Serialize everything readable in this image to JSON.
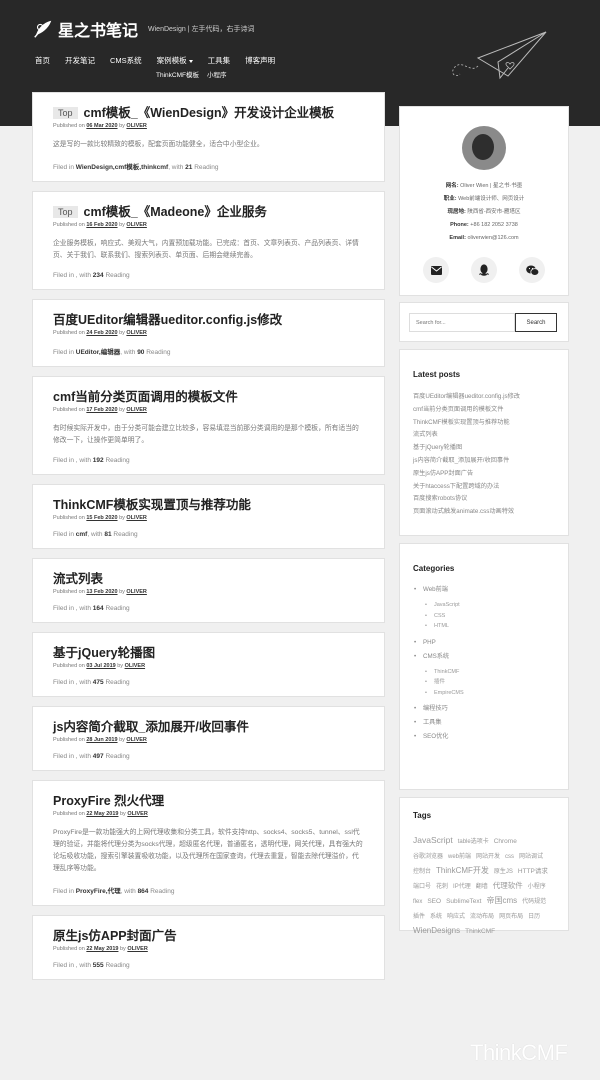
{
  "site": {
    "title": "星之书笔记",
    "description": "WienDesign | 左手代码，右手诗词"
  },
  "nav": {
    "items": [
      "首页",
      "开发笔记",
      "CMS系统",
      "案例模板",
      "工具集",
      "博客声明"
    ],
    "submenu": [
      "ThinkCMF模板",
      "小程序"
    ]
  },
  "posts": [
    {
      "top": "Top",
      "title": "cmf模板_《WienDesign》开发设计企业模板",
      "published": "Published on",
      "date": "06 Mar 2020",
      "by": "by",
      "author": "OLIVER",
      "excerpt": "这是写的一款比较精致的模板，配套页面功能健全，适合中小型企业。",
      "filed_prefix": "Filed in",
      "categories": "WienDesign,cmf模板,thinkcmf",
      "with": ", with",
      "count": "21",
      "reading": "Reading"
    },
    {
      "top": "Top",
      "title": "cmf模板_《Madeone》企业服务",
      "published": "Published on",
      "date": "16 Feb 2020",
      "by": "by",
      "author": "OLIVER",
      "excerpt": "企业服务模板，响应式、美观大气，内置预加载功能。已完成：首页、文章列表页、产品列表页、详情页、关于我们、联系我们、搜索列表页、单页面、后期会继续完善。",
      "filed_prefix": "Filed in",
      "categories": "",
      "with": ", with",
      "count": "234",
      "reading": "Reading"
    },
    {
      "top": "",
      "title": "百度UEditor编辑器ueditor.config.js修改",
      "published": "Published on",
      "date": "24 Feb 2020",
      "by": "by",
      "author": "OLIVER",
      "excerpt": "",
      "filed_prefix": "Filed in",
      "categories": "UEditor,编辑器",
      "with": ", with",
      "count": "90",
      "reading": "Reading"
    },
    {
      "top": "",
      "title": "cmf当前分类页面调用的模板文件",
      "published": "Published on",
      "date": "17 Feb 2020",
      "by": "by",
      "author": "OLIVER",
      "excerpt": "有时候实际开发中，由于分类可能会建立比较多，容易填混当前那分类调用的是那个模板，所有适当的修改一下，让操作更简单明了。",
      "filed_prefix": "Filed in",
      "categories": "",
      "with": ", with",
      "count": "192",
      "reading": "Reading"
    },
    {
      "top": "",
      "title": "ThinkCMF模板实现置顶与推荐功能",
      "published": "Published on",
      "date": "15 Feb 2020",
      "by": "by",
      "author": "OLIVER",
      "excerpt": "",
      "filed_prefix": "Filed in",
      "categories": "cmf",
      "with": ", with",
      "count": "81",
      "reading": "Reading"
    },
    {
      "top": "",
      "title": "流式列表",
      "published": "Published on",
      "date": "13 Feb 2020",
      "by": "by",
      "author": "OLIVER",
      "excerpt": "",
      "filed_prefix": "Filed in",
      "categories": "",
      "with": ", with",
      "count": "164",
      "reading": "Reading"
    },
    {
      "top": "",
      "title": "基于jQuery轮播图",
      "published": "Published on",
      "date": "03 Jul 2019",
      "by": "by",
      "author": "OLIVER",
      "excerpt": "",
      "filed_prefix": "Filed in",
      "categories": "",
      "with": ", with",
      "count": "475",
      "reading": "Reading"
    },
    {
      "top": "",
      "title": "js内容简介截取_添加展开/收回事件",
      "published": "Published on",
      "date": "28 Jun 2019",
      "by": "by",
      "author": "OLIVER",
      "excerpt": "",
      "filed_prefix": "Filed in",
      "categories": "",
      "with": ", with",
      "count": "497",
      "reading": "Reading"
    },
    {
      "top": "",
      "title": "ProxyFire 烈火代理",
      "published": "Published on",
      "date": "22 May 2019",
      "by": "by",
      "author": "OLIVER",
      "excerpt": "ProxyFire是一款功能强大的上网代理收集和分类工具，软件支持http、socks4、socks5、tunnel、ssl代理的验证，并能将代理分类为socks代理，超级匿名代理，普通匿名，透明代理，网关代理，具有强大的论坛吸收功能，搜索引擎装置吸收功能，以及代理所在国家查询，代理去重复，智能去除代理溢价，代理乱序等功能。",
      "filed_prefix": "Filed in",
      "categories": "ProxyFire,代理",
      "with": ", with",
      "count": "864",
      "reading": "Reading"
    },
    {
      "top": "",
      "title": "原生js仿APP封面广告",
      "published": "Published on",
      "date": "22 May 2019",
      "by": "by",
      "author": "OLIVER",
      "excerpt": "",
      "filed_prefix": "Filed in",
      "categories": "",
      "with": ", with",
      "count": "555",
      "reading": "Reading"
    }
  ],
  "profile": {
    "rows": [
      {
        "label": "网名:",
        "value": "Oliver Wien | 星之书·书墨"
      },
      {
        "label": "职业:",
        "value": "Web前端设计师、网页设计"
      },
      {
        "label": "现居地:",
        "value": "陕西省-西安市-雁塔区"
      },
      {
        "label": "Phone:",
        "value": "+86 182 2052 3738"
      },
      {
        "label": "Email:",
        "value": "oliverwien@126.com"
      }
    ]
  },
  "search": {
    "placeholder": "Search for...",
    "button": "Search"
  },
  "latest": {
    "title": "Latest posts",
    "items": [
      "百度UEditor编辑器ueditor.config.js修改",
      "cmf当前分类页面调用的模板文件",
      "ThinkCMF模板实现置顶与推荐功能",
      "流式列表",
      "基于jQuery轮播图",
      "js内容简介截取_添加展开/收回事件",
      "原生js仿APP封面广告",
      "关于htaccess下配置跨域的办法",
      "百度搜索robots协议",
      "页面滚动式触发animate.css动画特效"
    ]
  },
  "categories": {
    "title": "Categories",
    "groups": [
      {
        "name": "Web前端",
        "children": [
          "JavaScript",
          "CSS",
          "HTML"
        ]
      },
      {
        "name": "PHP",
        "children": []
      },
      {
        "name": "CMS系统",
        "children": [
          "ThinkCMF",
          "插件",
          "EmpireCMS"
        ]
      },
      {
        "name": "编程技巧",
        "children": []
      },
      {
        "name": "工具集",
        "children": []
      },
      {
        "name": "SEO优化",
        "children": []
      }
    ]
  },
  "tags": {
    "title": "Tags",
    "items": [
      {
        "t": "JavaScript",
        "s": 8.5
      },
      {
        "t": "table选项卡",
        "s": 6
      },
      {
        "t": "Chrome",
        "s": 6.5
      },
      {
        "t": "谷歌浏览器",
        "s": 6
      },
      {
        "t": "web前端",
        "s": 6
      },
      {
        "t": "网站开发",
        "s": 6
      },
      {
        "t": "css",
        "s": 6
      },
      {
        "t": "网站调试",
        "s": 6
      },
      {
        "t": "控制台",
        "s": 6
      },
      {
        "t": "ThinkCMF开发",
        "s": 8
      },
      {
        "t": "原生JS",
        "s": 6
      },
      {
        "t": "HTTP请求",
        "s": 6.5
      },
      {
        "t": "端口号",
        "s": 6
      },
      {
        "t": "花刺",
        "s": 6
      },
      {
        "t": "IP代理",
        "s": 6
      },
      {
        "t": "翻墙",
        "s": 6
      },
      {
        "t": "代理软件",
        "s": 7.5
      },
      {
        "t": "小程序",
        "s": 6
      },
      {
        "t": "flex",
        "s": 6
      },
      {
        "t": "SEO",
        "s": 6.5
      },
      {
        "t": "SublimeText",
        "s": 6.5
      },
      {
        "t": "帝国cms",
        "s": 8
      },
      {
        "t": "代码规范",
        "s": 6
      },
      {
        "t": "插件",
        "s": 6
      },
      {
        "t": "系统",
        "s": 6
      },
      {
        "t": "响应式",
        "s": 6
      },
      {
        "t": "流动布局",
        "s": 6
      },
      {
        "t": "网页布局",
        "s": 6
      },
      {
        "t": "日历",
        "s": 6
      },
      {
        "t": "WienDesigns",
        "s": 8
      },
      {
        "t": "ThinkCMF",
        "s": 6.5
      }
    ]
  },
  "watermark": "ThinkCMF"
}
